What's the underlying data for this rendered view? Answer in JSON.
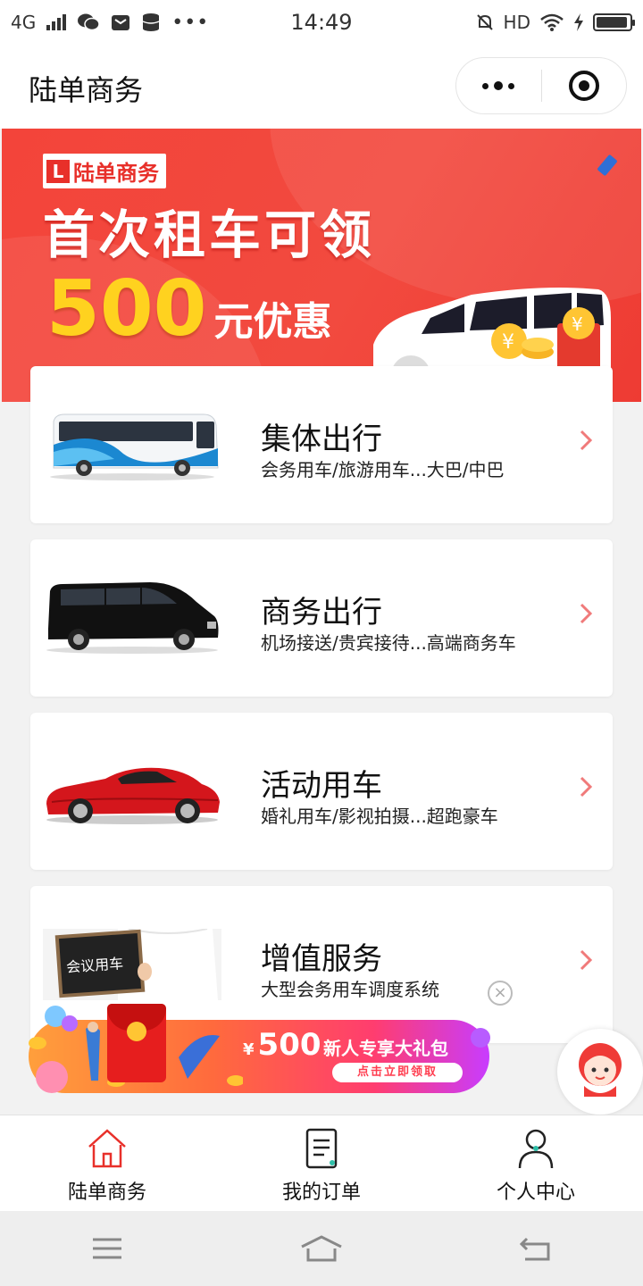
{
  "status_bar": {
    "network": "4G",
    "time": "14:49",
    "hd": "HD",
    "battery_level": 0.95,
    "icons": [
      "signal-icon",
      "wechat-icon",
      "mail-icon",
      "database-icon",
      "more-icon",
      "mute-icon",
      "wifi-icon",
      "charging-icon",
      "battery-icon"
    ]
  },
  "header": {
    "title": "陆单商务",
    "icons": [
      "more-dots-icon",
      "record-target-icon"
    ]
  },
  "banner": {
    "brand": "陆单商务",
    "headline": "首次租车可领",
    "amount": "500",
    "unit": "元优惠"
  },
  "services": [
    {
      "name": "集体出行",
      "desc": "会务用车/旅游用车...大巴/中巴",
      "image": "bus"
    },
    {
      "name": "商务出行",
      "desc": "机场接送/贵宾接待...高端商务车",
      "image": "business-van"
    },
    {
      "name": "活动用车",
      "desc": "婚礼用车/影视拍摄...超跑豪车",
      "image": "sports-car"
    },
    {
      "name": "增值服务",
      "desc": "大型会务用车调度系统",
      "image": "meeting-sign",
      "sign_text": "会议用车"
    }
  ],
  "promo": {
    "currency": "¥",
    "amount": "500",
    "title": "新人专享大礼包",
    "button": "点击立即领取",
    "close": "×"
  },
  "tabs": [
    {
      "label": "陆单商务",
      "icon": "home-icon"
    },
    {
      "label": "我的订单",
      "icon": "order-icon"
    },
    {
      "label": "个人中心",
      "icon": "user-icon"
    }
  ],
  "colors": {
    "brand_red": "#e8302a",
    "banner_bg": "#f3443a",
    "offer_yellow": "#ffd21f",
    "chevron": "#f07a7a"
  }
}
